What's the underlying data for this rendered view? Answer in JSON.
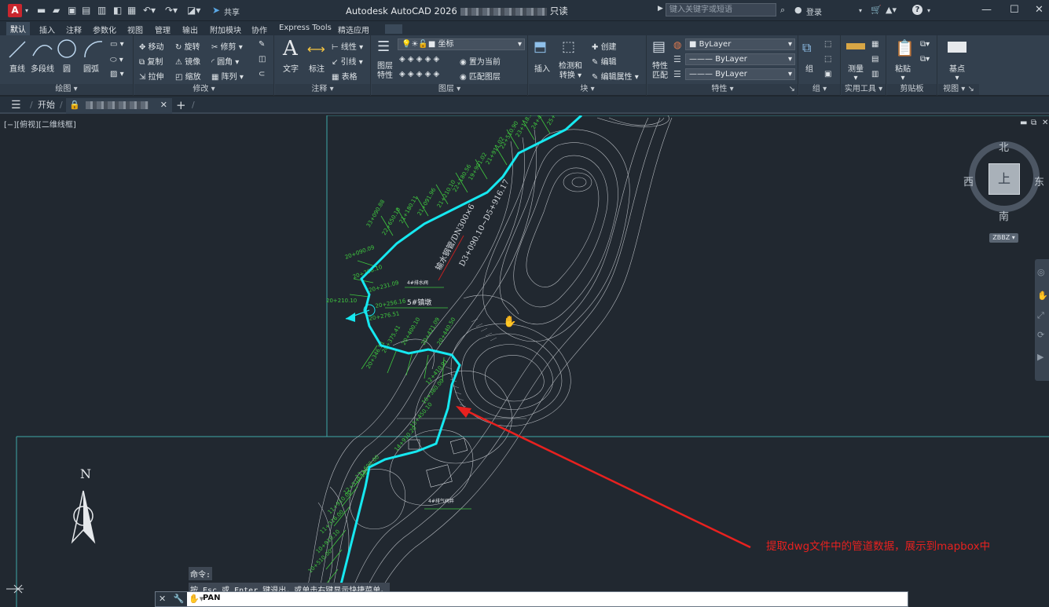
{
  "titlebar": {
    "app_icon": "A",
    "title": "Autodesk AutoCAD 2026",
    "title_suffix": "只读",
    "share": "共享",
    "search_placeholder": "键入关键字或短语",
    "login": "登录",
    "help": "?"
  },
  "menus": [
    "默认",
    "插入",
    "注释",
    "参数化",
    "视图",
    "管理",
    "输出",
    "附加模块",
    "协作",
    "Express Tools",
    "精选应用"
  ],
  "ribbon": {
    "draw": {
      "title": "绘图",
      "line": "直线",
      "polyline": "多段线",
      "circle": "圆",
      "arc": "圆弧"
    },
    "modify": {
      "title": "修改",
      "move": "移动",
      "rotate": "旋转",
      "trim": "修剪",
      "copy": "复制",
      "mirror": "镜像",
      "fillet": "圆角",
      "stretch": "拉伸",
      "scale": "缩放",
      "array": "阵列"
    },
    "annotation": {
      "title": "注释",
      "text": "文字",
      "dimension": "标注",
      "linear": "线性",
      "leader": "引线",
      "table": "表格"
    },
    "layers": {
      "title": "图层",
      "layer_props_1": "图层",
      "layer_props_2": "特性",
      "current_layer": "坐标",
      "make_current": "置为当前",
      "match_layer": "匹配图层"
    },
    "block": {
      "title": "块",
      "insert": "插入",
      "detect_1": "检测和",
      "detect_2": "转换",
      "create": "创建",
      "edit": "编辑",
      "edit_attr": "编辑属性"
    },
    "properties": {
      "title": "特性",
      "match_1": "特性",
      "match_2": "匹配",
      "color": "ByLayer",
      "linetype": "ByLayer",
      "lineweight": "ByLayer"
    },
    "groups": {
      "title": "组",
      "group": "组"
    },
    "utilities": {
      "title": "实用工具",
      "measure": "测量"
    },
    "clipboard": {
      "title": "剪贴板",
      "paste": "粘贴"
    },
    "view": {
      "title": "视图",
      "base": "基点"
    }
  },
  "tabs": {
    "start": "开始",
    "add": "+"
  },
  "viewport": {
    "label": "[−][俯视][二维线框]",
    "compass": {
      "north": "北",
      "south": "南",
      "east": "东",
      "west": "西",
      "top": "上",
      "wcs": "ZBBZ"
    },
    "drawing_labels": {
      "pipe_label_1": "输水钢管/DN300×6",
      "pipe_label_2": "D3+090.10~D5+916.17",
      "label_5": "5#镇墩",
      "label_valve": "4#排气阀井",
      "label_pump": "4#排水阀",
      "north_letter": "N"
    },
    "annotation": "提取dwg文件中的管道数据，展示到mapbox中"
  },
  "command": {
    "prompt": "命令:",
    "hint": "按 Esc 或 Enter 键退出，或单击右键显示快捷菜单。",
    "current": "PAN"
  },
  "colors": {
    "pipe": "#16e8f0",
    "contour": "#d2d6da",
    "station_labels": "#3fc83f",
    "annotation": "#e8211f",
    "background": "#212830"
  }
}
